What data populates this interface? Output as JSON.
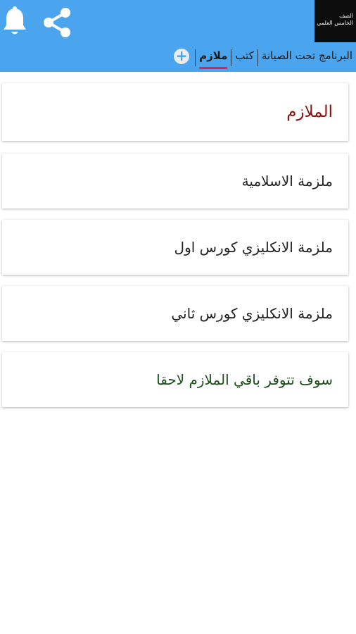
{
  "app_bar": {
    "logo_text": [
      "الصف",
      "الخامس العلمي"
    ],
    "icons": {
      "notifications": "bell-icon",
      "share": "share-icon",
      "add_tab": "plus-circle-icon"
    },
    "colors": {
      "bar": "#4aa4ee",
      "active_indicator": "#e8195c",
      "header_text": "#8b1010",
      "note_text": "#1c4d1c"
    }
  },
  "tabs": [
    {
      "label": "البرنامج تحت الصيانة",
      "active": false
    },
    {
      "label": "كتب",
      "active": false
    },
    {
      "label": "ملازم",
      "active": true
    }
  ],
  "section": {
    "title": "الملازم"
  },
  "items": [
    {
      "label": "ملزمة الاسلامية"
    },
    {
      "label": "ملزمة الانكليزي كورس اول"
    },
    {
      "label": "ملزمة الانكليزي كورس ثاني"
    },
    {
      "label": "سوف تتوفر باقي الملازم لاحقا"
    }
  ]
}
